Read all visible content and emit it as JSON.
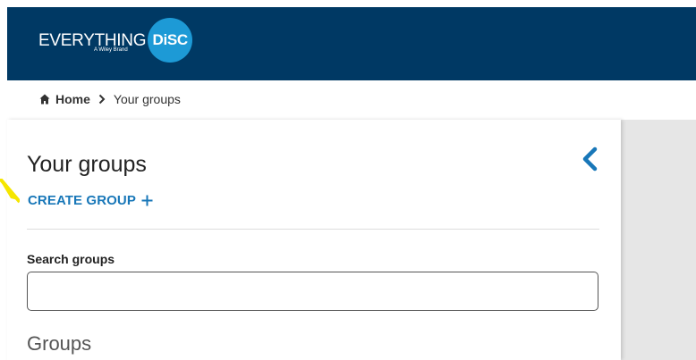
{
  "header": {
    "logo_text": "EVERYTHING",
    "logo_badge": "DiSC",
    "logo_tagline": "A Wiley Brand",
    "bg_color": "#003964",
    "badge_color": "#1d9ad6"
  },
  "breadcrumb": {
    "home_label": "Home",
    "current_label": "Your groups"
  },
  "panel": {
    "title": "Your groups",
    "create_label": "CREATE GROUP",
    "search_label": "Search groups",
    "search_value": "",
    "groups_heading": "Groups"
  },
  "icons": [
    "home-icon",
    "chevron-right-icon",
    "chevron-left-icon",
    "plus-icon"
  ],
  "colors": {
    "accent": "#1877b8",
    "annotation": "#f5e600"
  }
}
